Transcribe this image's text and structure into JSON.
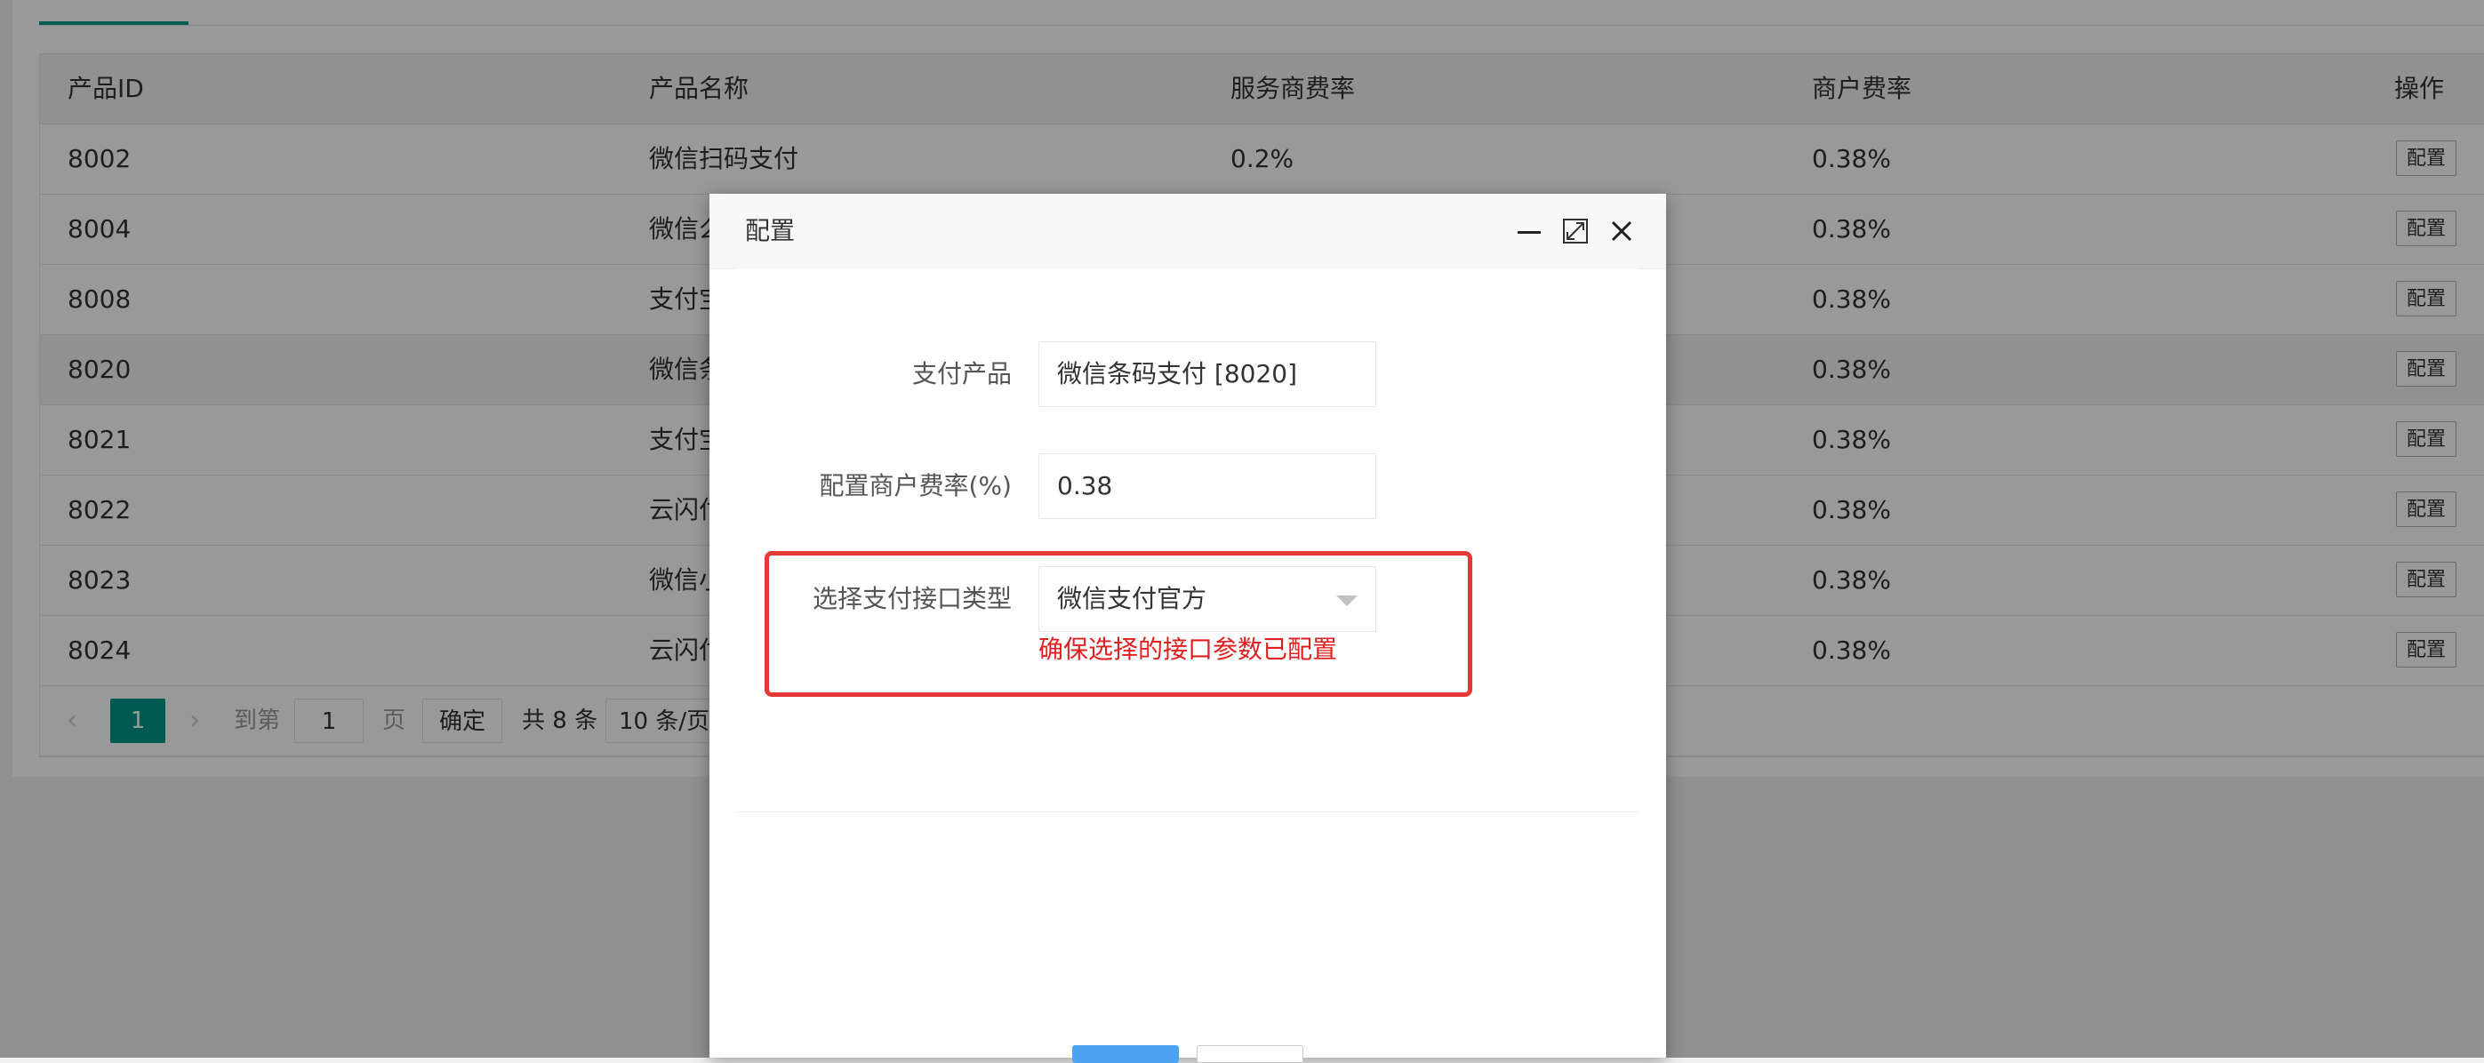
{
  "table": {
    "headers": [
      "产品ID",
      "产品名称",
      "服务商费率",
      "商户费率",
      "操作"
    ],
    "rows": [
      {
        "id": "8002",
        "name": "微信扫码支付",
        "provider_rate": "0.2%",
        "merchant_rate": "0.38%",
        "action": "配置"
      },
      {
        "id": "8004",
        "name": "微信么",
        "provider_rate": "",
        "merchant_rate": "0.38%",
        "action": "配置"
      },
      {
        "id": "8008",
        "name": "支付宝",
        "provider_rate": "",
        "merchant_rate": "0.38%",
        "action": "配置"
      },
      {
        "id": "8020",
        "name": "微信条",
        "provider_rate": "",
        "merchant_rate": "0.38%",
        "action": "配置"
      },
      {
        "id": "8021",
        "name": "支付宝",
        "provider_rate": "",
        "merchant_rate": "0.38%",
        "action": "配置"
      },
      {
        "id": "8022",
        "name": "云闪付",
        "provider_rate": "",
        "merchant_rate": "0.38%",
        "action": "配置"
      },
      {
        "id": "8023",
        "name": "微信小",
        "provider_rate": "",
        "merchant_rate": "0.38%",
        "action": "配置"
      },
      {
        "id": "8024",
        "name": "云闪付",
        "provider_rate": "",
        "merchant_rate": "0.38%",
        "action": "配置"
      }
    ]
  },
  "pager": {
    "prev": "‹",
    "current_page": "1",
    "next": "›",
    "goto_label": "到第",
    "goto_value": "1",
    "page_unit": "页",
    "confirm": "确定",
    "total": "共 8 条",
    "page_size": "10 条/页"
  },
  "modal": {
    "title": "配置",
    "fields": {
      "product_label": "支付产品",
      "product_value": "微信条码支付 [8020]",
      "rate_label": "配置商户费率(%)",
      "rate_value": "0.38",
      "interface_label": "选择支付接口类型",
      "interface_value": "微信支付官方",
      "interface_hint": "确保选择的接口参数已配置"
    }
  },
  "colors": {
    "accent": "#009688",
    "highlight_border": "#e53935",
    "hint_text": "#e02020",
    "primary_button": "#4da3f0"
  }
}
